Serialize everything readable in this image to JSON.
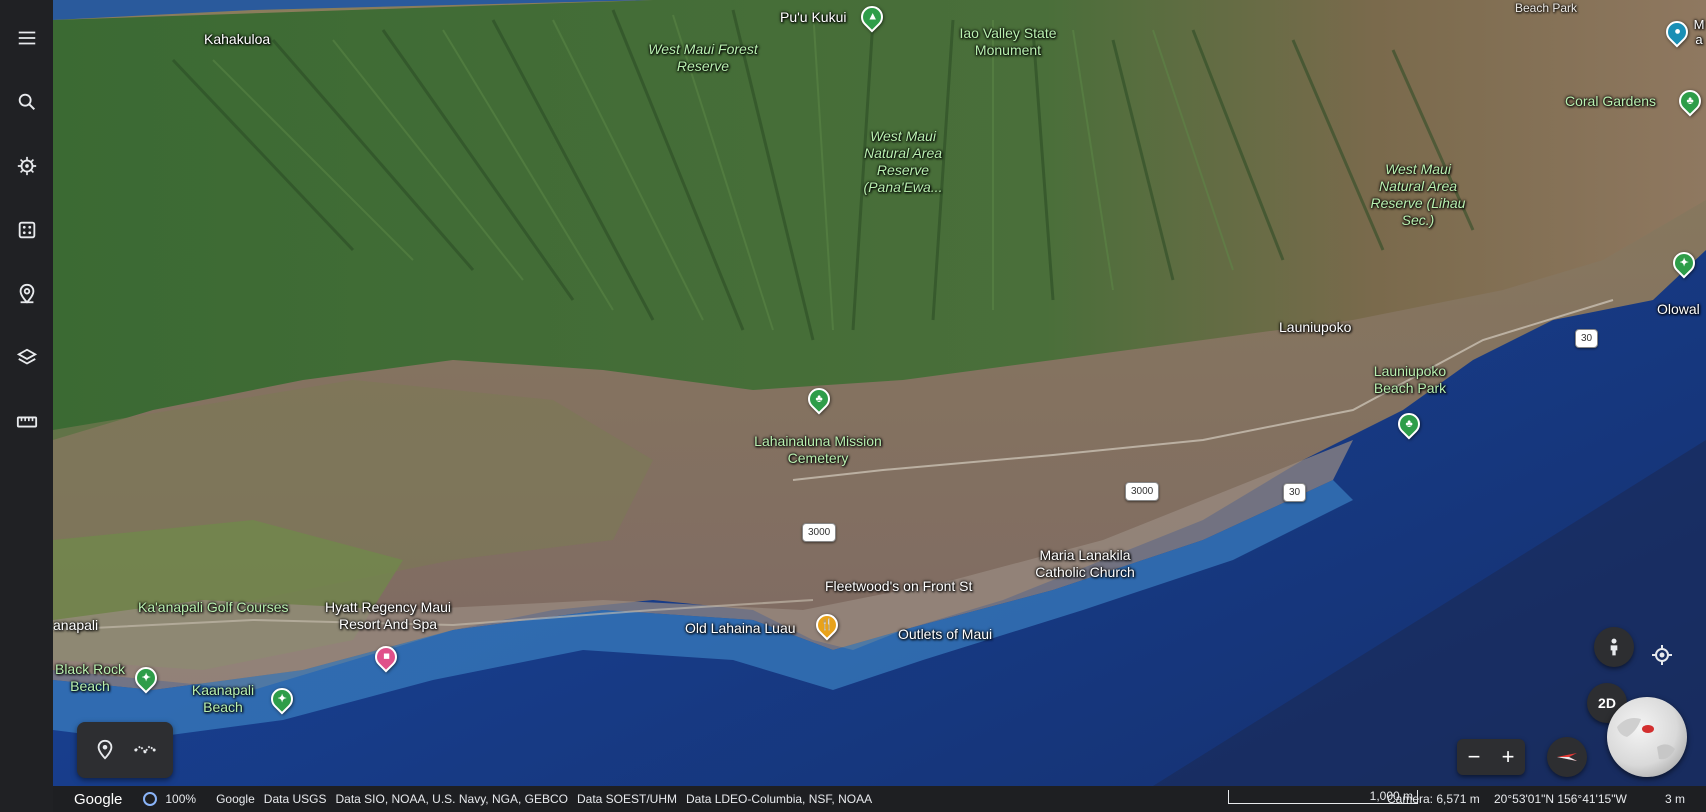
{
  "sidebar": {
    "items": [
      {
        "icon": "menu-icon",
        "label": "Menu"
      },
      {
        "icon": "search-icon",
        "label": "Search"
      },
      {
        "icon": "voyager-icon",
        "label": "Voyager"
      },
      {
        "icon": "feeling-lucky-icon",
        "label": "I'm Feeling Lucky"
      },
      {
        "icon": "projects-icon",
        "label": "Projects"
      },
      {
        "icon": "map-style-icon",
        "label": "Map Style"
      },
      {
        "icon": "measure-icon",
        "label": "Measure"
      }
    ]
  },
  "map": {
    "labels": {
      "kahakuloa": "Kahakuloa",
      "puu_kukui": "Pu'u Kukui",
      "west_maui_forest": "West Maui Forest Reserve",
      "iao_valley": "Iao Valley State Monument",
      "coral_gardens": "Coral Gardens",
      "wm_natural_pana": "West Maui Natural Area Reserve (Pana'Ewa...",
      "wm_natural_lihau": "West Maui Natural Area Reserve (Lihau Sec.)",
      "launiupoko": "Launiupoko",
      "launiupoko_park": "Launiupoko Beach Park",
      "olowalu": "Olowal",
      "top_right_clip": "M a",
      "lahainaluna": "Lahainaluna Mission Cemetery",
      "maria_lanakila": "Maria Lanakila Catholic Church",
      "fleetwoods": "Fleetwood's on Front St",
      "old_lahaina_luau": "Old Lahaina Luau",
      "outlets": "Outlets of Maui",
      "kaanapali_golf": "Ka'anapali Golf Courses",
      "hyatt": "Hyatt Regency Maui Resort And Spa",
      "anapali": "anapali",
      "black_rock": "Black Rock Beach",
      "kaanapali_beach": "Kaanapali Beach",
      "top_beach_park": "Beach Park"
    },
    "road_shields": [
      "30",
      "3000",
      "30",
      "3000"
    ]
  },
  "tools": {
    "placemark_icon": "placemark-icon",
    "path_icon": "path-icon"
  },
  "controls": {
    "btn_2d": "2D",
    "zoom_out": "−",
    "zoom_in": "+"
  },
  "status": {
    "google_logo": "Google",
    "load_percent": "100%",
    "attributions": [
      "Google",
      "Data USGS",
      "Data SIO, NOAA, U.S. Navy, NGA, GEBCO",
      "Data SOEST/UHM",
      "Data LDEO-Columbia, NSF, NOAA"
    ],
    "scale": "1,000 m",
    "camera": "Camera: 6,571 m",
    "coords": "20°53'01\"N 156°41'15\"W",
    "elevation": "3 m"
  }
}
